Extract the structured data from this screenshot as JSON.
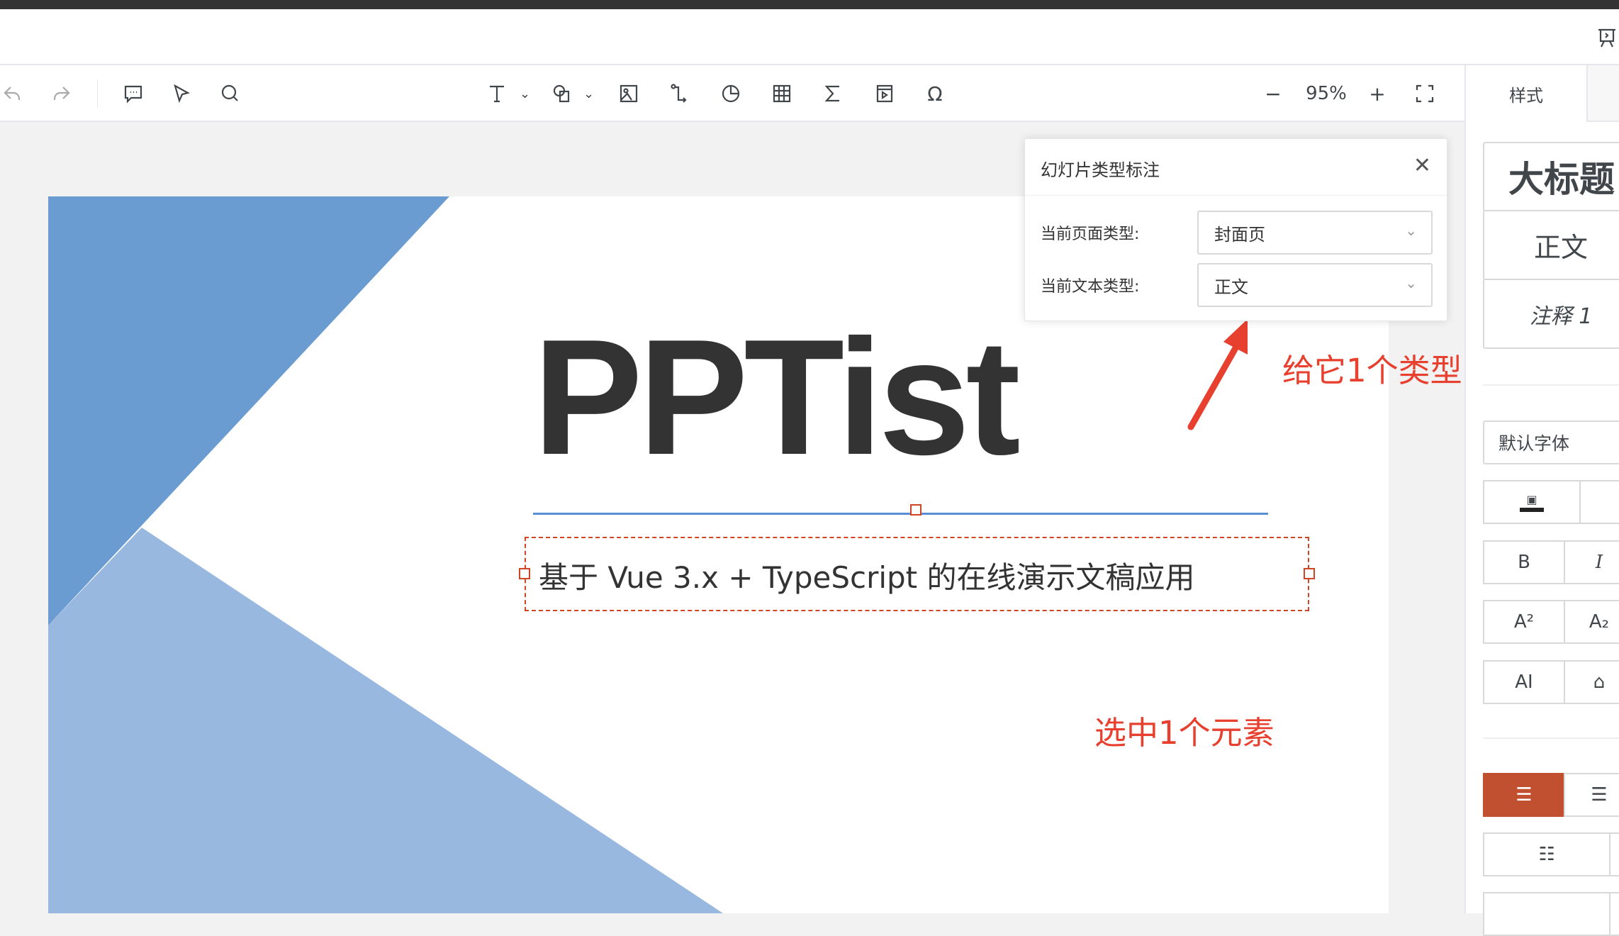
{
  "toolbar": {
    "icons": [
      "undo-icon",
      "redo-icon",
      "comment-icon",
      "pointer-icon",
      "zoom-search-icon",
      "text-icon",
      "shape-icon",
      "image-icon",
      "line-icon",
      "chart-icon",
      "table-icon",
      "formula-icon",
      "video-icon",
      "symbol-icon"
    ],
    "zoom_value": "95%",
    "zoom_minus": "−",
    "zoom_plus": "+"
  },
  "right_panel": {
    "tab_style": "样式",
    "text_styles": [
      "大标题",
      "正文",
      "注释 1"
    ],
    "font_family": "默认字体",
    "bold": "B",
    "italic": "I",
    "superscript": "A²",
    "subscript": "A₂",
    "ai": "AI",
    "accent_color": "#c0502f"
  },
  "dialog": {
    "title": "幻灯片类型标注",
    "page_type_label": "当前页面类型:",
    "page_type_value": "封面页",
    "text_type_label": "当前文本类型:",
    "text_type_value": "正文"
  },
  "slide": {
    "title": "PPTist",
    "subtitle": "基于 Vue 3.x + TypeScript 的在线演示文稿应用",
    "colors": {
      "dark_blue": "#6a9bd1",
      "light_blue": "#98b8df",
      "line": "#5b8fd4"
    }
  },
  "annotations": {
    "give_type": "给它1个类型",
    "select_element": "选中1个元素",
    "color": "#e8402f"
  }
}
